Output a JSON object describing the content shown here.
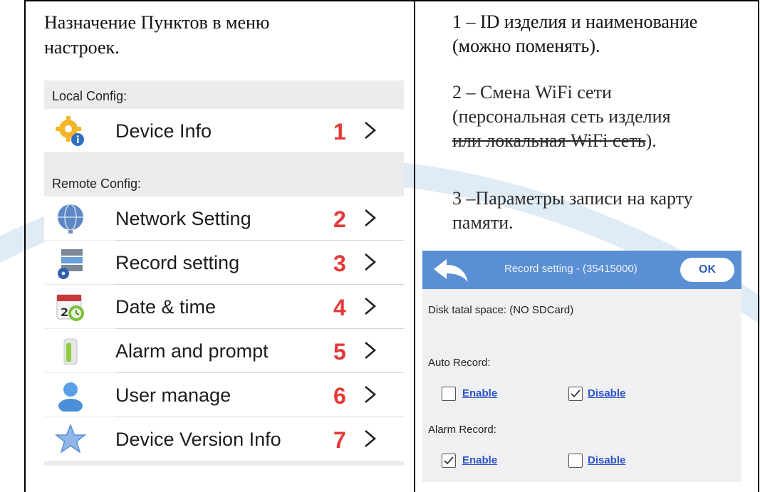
{
  "left": {
    "title_line1": "Назначение Пунктов в меню",
    "title_line2": "настроек.",
    "local_config_header": "Local Config:",
    "remote_config_header": "Remote Config:",
    "items": [
      {
        "label": "Device Info",
        "num": "1",
        "icon": "gear-info-icon"
      },
      {
        "label": "Network Setting",
        "num": "2",
        "icon": "globe-network-icon"
      },
      {
        "label": "Record setting",
        "num": "3",
        "icon": "server-disk-icon"
      },
      {
        "label": "Date & time",
        "num": "4",
        "icon": "calendar-clock-icon"
      },
      {
        "label": "Alarm and prompt",
        "num": "5",
        "icon": "alarm-bottle-icon"
      },
      {
        "label": "User manage",
        "num": "6",
        "icon": "user-icon"
      },
      {
        "label": "Device Version Info",
        "num": "7",
        "icon": "star-icon"
      }
    ]
  },
  "right": {
    "note1_line1": "1 – ID изделия и наименование",
    "note1_line2": "(можно поменять).",
    "note2_line1": "2 – Смена WiFi сети",
    "note2_line2": "(персональная сеть изделия",
    "note2_line3_struck": "или локальная WiFi сеть",
    "note2_line3_end": ").",
    "note3_line1": "3 –Параметры записи на карту",
    "note3_line2": "памяти."
  },
  "record_setting": {
    "title": "Record setting  - (35415000)",
    "ok": "OK",
    "disk": "Disk  tatal space:  (NO SDCard)",
    "auto_record": "Auto Record:",
    "alarm_record": "Alarm Record:",
    "enable": "Enable",
    "disable": "Disable",
    "auto_enable_checked": false,
    "auto_disable_checked": true,
    "alarm_enable_checked": true,
    "alarm_disable_checked": false
  },
  "colors": {
    "number_red": "#e23a3a",
    "header_blue": "#5b8fd4",
    "link_blue": "#2b54c9",
    "watermark": "#cfe2f1"
  }
}
